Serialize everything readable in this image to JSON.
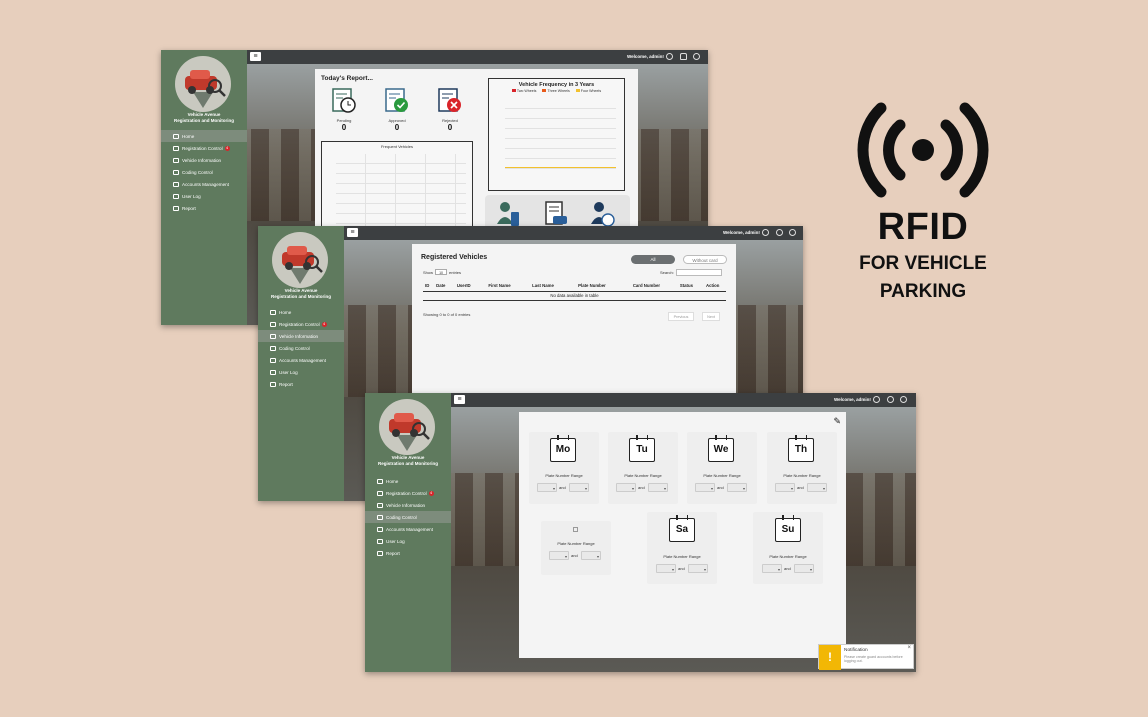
{
  "brand": {
    "line1": "Vehicle Avenue",
    "line2": "Registration and Monitoring"
  },
  "nav": [
    {
      "label": "Home",
      "icon": "home-icon"
    },
    {
      "label": "Registration Control",
      "icon": "clipboard-icon",
      "badge": "4"
    },
    {
      "label": "Vehicle Information",
      "icon": "car-icon"
    },
    {
      "label": "Coding Control",
      "icon": "calendar-icon"
    },
    {
      "label": "Accounts Management",
      "icon": "users-icon"
    },
    {
      "label": "User Log",
      "icon": "user-log-icon"
    },
    {
      "label": "Report",
      "icon": "report-icon"
    }
  ],
  "topbar": {
    "welcome": "Welcome, admin!"
  },
  "dashboard": {
    "title": "Today's Report...",
    "stats": [
      {
        "label": "Pending",
        "value": "0",
        "icon": "pending-clock-icon",
        "color": "#3a6a5c"
      },
      {
        "label": "Approved",
        "value": "0",
        "icon": "approved-check-icon",
        "color": "#2a9a3e"
      },
      {
        "label": "Rejected",
        "value": "0",
        "icon": "rejected-x-icon",
        "color": "#d9242a"
      }
    ],
    "frequent_title": "Frequent Vehicles",
    "freq_chart": {
      "title": "Vehicle Frequency in 3 Years",
      "legend": [
        "Two Wheels",
        "Three Wheels",
        "Four Wheels"
      ],
      "legend_colors": [
        "#d9242a",
        "#e85a1a",
        "#f2c12e"
      ]
    }
  },
  "registered": {
    "title": "Registered Vehicles",
    "filters": [
      "All",
      "Without card"
    ],
    "show": "Show",
    "show_value": "10",
    "entries": "entries",
    "search": "Search:",
    "columns": [
      "ID",
      "Date",
      "UserID",
      "First Name",
      "Last Name",
      "Plate Number",
      "Card Number",
      "Status",
      "Action"
    ],
    "empty": "No data available in table",
    "info": "Showing 0 to 0 of 0 entries",
    "prev": "Previous",
    "next": "Next"
  },
  "coding": {
    "range_label": "Plate Number Range",
    "and": "and",
    "days": [
      "Mo",
      "Tu",
      "We",
      "Th",
      "",
      "Sa",
      "Su"
    ]
  },
  "notification": {
    "title": "Notification",
    "body": "Please create guard accounts before logging out.",
    "close": "×",
    "icon_text": "!"
  },
  "promo": {
    "title": "RFID",
    "line1": "FOR VEHICLE",
    "line2": "PARKING"
  }
}
